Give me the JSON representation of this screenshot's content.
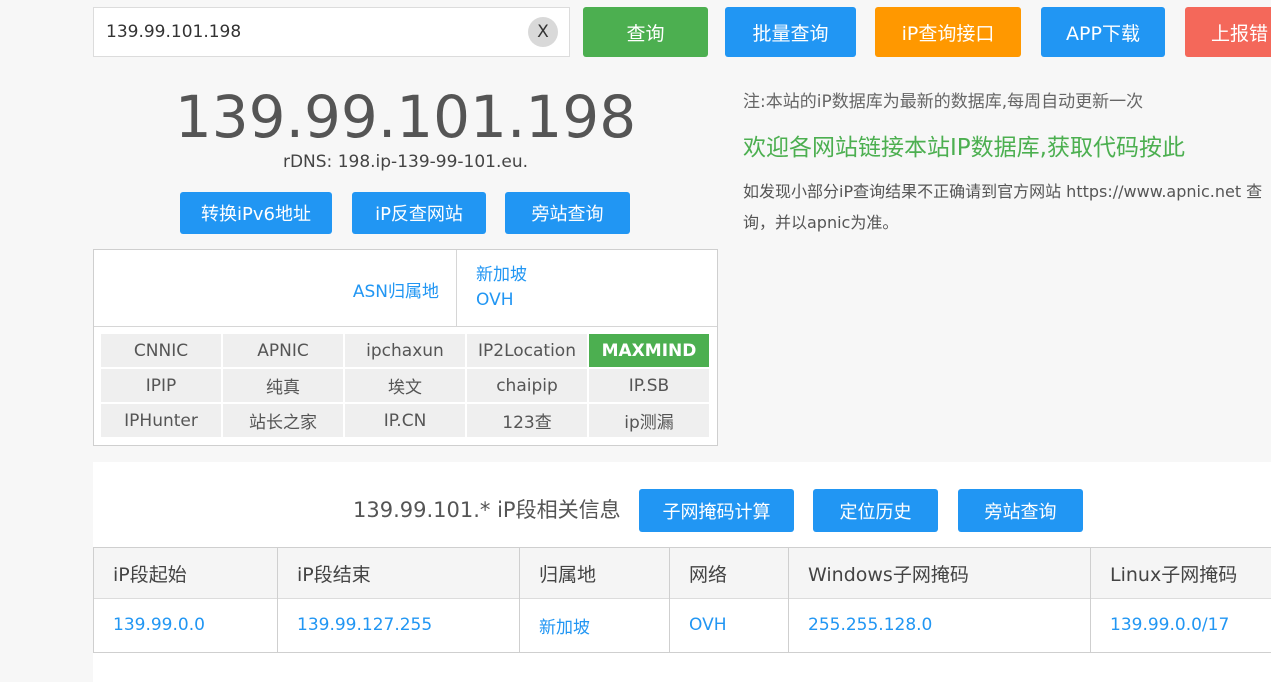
{
  "search": {
    "value": "139.99.101.198",
    "clear_label": "X"
  },
  "toolbar": {
    "query": "查询",
    "batch_query": "批量查询",
    "api": "iP查询接口",
    "app_download": "APP下载",
    "report_error": "上报错"
  },
  "ip_info": {
    "ip": "139.99.101.198",
    "rdns": "rDNS: 198.ip-139-99-101.eu.",
    "actions": {
      "ipv6": "转换iPv6地址",
      "reverse": "iP反查网站",
      "sidesite": "旁站查询"
    }
  },
  "asn": {
    "label": "ASN归属地",
    "country": "新加坡",
    "isp": "OVH"
  },
  "sources": [
    {
      "label": "CNNIC",
      "active": false
    },
    {
      "label": "APNIC",
      "active": false
    },
    {
      "label": "ipchaxun",
      "active": false
    },
    {
      "label": "IP2Location",
      "active": false
    },
    {
      "label": "MAXMIND",
      "active": true
    },
    {
      "label": "IPIP",
      "active": false
    },
    {
      "label": "纯真",
      "active": false
    },
    {
      "label": "埃文",
      "active": false
    },
    {
      "label": "chaipip",
      "active": false
    },
    {
      "label": "IP.SB",
      "active": false
    },
    {
      "label": "IPHunter",
      "active": false
    },
    {
      "label": "站长之家",
      "active": false
    },
    {
      "label": "IP.CN",
      "active": false
    },
    {
      "label": "123查",
      "active": false
    },
    {
      "label": "ip测漏",
      "active": false
    }
  ],
  "notes": {
    "note": "注:本站的iP数据库为最新的数据库,每周自动更新一次",
    "link": "欢迎各网站链接本站IP数据库,获取代码按此",
    "desc": "如发现小部分iP查询结果不正确请到官方网站 https://www.apnic.net 查询，并以apnic为准。"
  },
  "segment": {
    "title": "139.99.101.* iP段相关信息",
    "buttons": {
      "subnet": "子网掩码计算",
      "history": "定位历史",
      "sidesite": "旁站查询"
    },
    "headers": [
      "iP段起始",
      "iP段结束",
      "归属地",
      "网络",
      "Windows子网掩码",
      "Linux子网掩码"
    ],
    "row": [
      "139.99.0.0",
      "139.99.127.255",
      "新加坡",
      "OVH",
      "255.255.128.0",
      "139.99.0.0/17"
    ]
  },
  "colors": {
    "blue": "#2196f3",
    "green": "#4caf50",
    "orange": "#ff9800",
    "red": "#f4685a"
  }
}
